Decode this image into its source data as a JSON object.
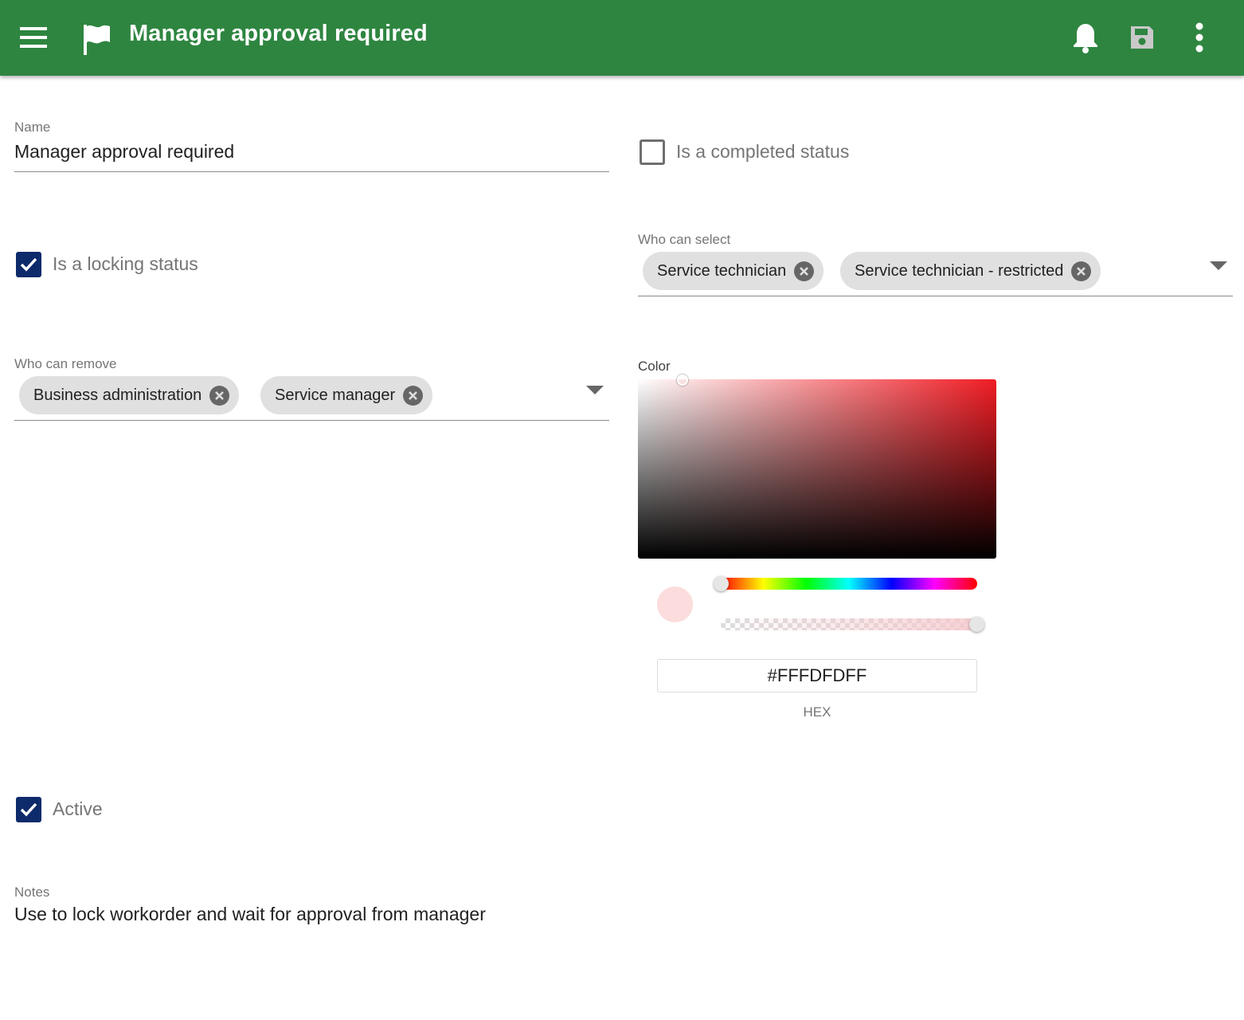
{
  "appbar": {
    "title": "Manager approval required",
    "menu_icon": "menu-icon",
    "flag_icon": "flag-icon",
    "notifications_icon": "bell-icon",
    "save_icon": "save-icon",
    "more_icon": "more-vert-icon",
    "color": "#2e8540"
  },
  "form": {
    "name": {
      "label": "Name",
      "value": "Manager approval required"
    },
    "is_completed": {
      "label": "Is a completed status",
      "checked": false
    },
    "is_locking": {
      "label": "Is a locking status",
      "checked": true
    },
    "who_can_select": {
      "label": "Who can select",
      "chips": [
        {
          "label": "Service technician"
        },
        {
          "label": "Service technician - restricted"
        }
      ]
    },
    "who_can_remove": {
      "label": "Who can remove",
      "chips": [
        {
          "label": "Business administration"
        },
        {
          "label": "Service manager"
        }
      ]
    },
    "color": {
      "label": "Color",
      "hex_value": "#FFFDFDFF",
      "hex_label": "HEX",
      "hue_level": 0,
      "alpha_level": 1.0,
      "preview_color": "#fcdcdc"
    },
    "active": {
      "label": "Active",
      "checked": true
    },
    "notes": {
      "label": "Notes",
      "value": "Use to lock workorder and wait for approval from manager"
    }
  }
}
